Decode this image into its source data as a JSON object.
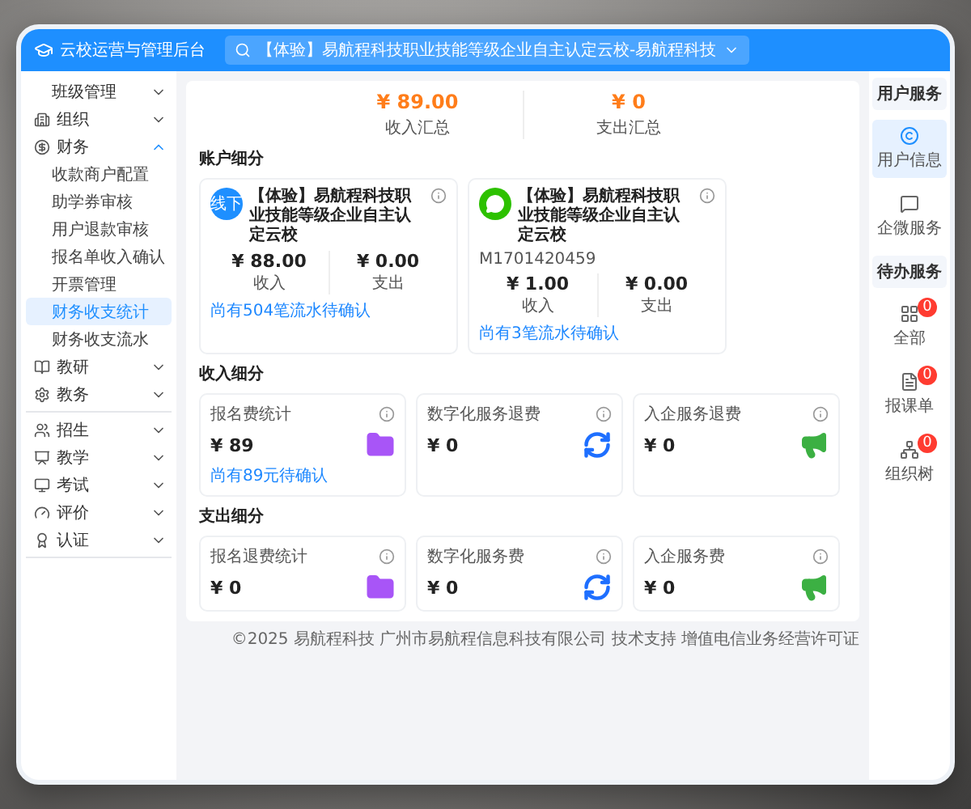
{
  "app": {
    "title": "云校运营与管理后台",
    "search": {
      "value": "【体验】易航程科技职业技能等级企业自主认定云校-易航程科技"
    }
  },
  "sidebar": {
    "groups": [
      [
        {
          "label": "班级管理",
          "kind": "submenu",
          "expanded": false
        },
        {
          "label": "组织",
          "kind": "module",
          "expanded": false
        },
        {
          "label": "财务",
          "kind": "module",
          "expanded": true,
          "children": [
            {
              "label": "收款商户配置",
              "selected": false
            },
            {
              "label": "助学券审核",
              "selected": false
            },
            {
              "label": "用户退款审核",
              "selected": false
            },
            {
              "label": "报名单收入确认",
              "selected": false
            },
            {
              "label": "开票管理",
              "selected": false
            },
            {
              "label": "财务收支统计",
              "selected": true
            },
            {
              "label": "财务收支流水",
              "selected": false
            }
          ]
        },
        {
          "label": "教研",
          "kind": "module",
          "expanded": false
        },
        {
          "label": "教务",
          "kind": "module",
          "expanded": false
        }
      ],
      [
        {
          "label": "招生",
          "kind": "module",
          "expanded": false
        },
        {
          "label": "教学",
          "kind": "module",
          "expanded": false
        },
        {
          "label": "考试",
          "kind": "module",
          "expanded": false
        },
        {
          "label": "评价",
          "kind": "module",
          "expanded": false
        },
        {
          "label": "认证",
          "kind": "module",
          "expanded": false
        }
      ]
    ]
  },
  "summary": [
    {
      "amount": "¥ 89.00",
      "label": "收入汇总"
    },
    {
      "amount": "¥ 0",
      "label": "支出汇总"
    }
  ],
  "accounts": {
    "title": "账户细分",
    "cards": [
      {
        "kind": "offline",
        "badge": "线下",
        "name": "【体验】易航程科技职业技能等级企业自主认定云校",
        "income": "¥ 88.00",
        "income_label": "收入",
        "expense": "¥ 0.00",
        "expense_label": "支出",
        "link": "尚有504笔流水待确认"
      },
      {
        "kind": "wechat",
        "name": "【体验】易航程科技职业技能等级企业自主认定云校",
        "id": "M1701420459",
        "income": "¥ 1.00",
        "income_label": "收入",
        "expense": "¥ 0.00",
        "expense_label": "支出",
        "link": "尚有3笔流水待确认"
      }
    ]
  },
  "sections": [
    {
      "title": "收入细分",
      "cards": [
        {
          "kind": "folder",
          "title": "报名费统计",
          "amount": "¥ 89",
          "link": "尚有89元待确认"
        },
        {
          "kind": "digital",
          "title": "数字化服务退费",
          "amount": "¥ 0"
        },
        {
          "kind": "enterprise",
          "title": "入企服务退费",
          "amount": "¥ 0"
        }
      ]
    },
    {
      "title": "支出细分",
      "cards": [
        {
          "kind": "folder",
          "title": "报名退费统计",
          "amount": "¥ 0"
        },
        {
          "kind": "digital",
          "title": "数字化服务费",
          "amount": "¥ 0"
        },
        {
          "kind": "enterprise",
          "title": "入企服务费",
          "amount": "¥ 0"
        }
      ]
    }
  ],
  "footer": "©2025 易航程科技 广州市易航程信息科技有限公司 技术支持 增值电信业务经营许可证",
  "right_panel": [
    {
      "title": "用户服务",
      "items": [
        {
          "label": "用户信息",
          "kind": "user",
          "selected": true
        },
        {
          "label": "企微服务",
          "kind": "chat",
          "selected": false
        }
      ]
    },
    {
      "title": "待办服务",
      "items": [
        {
          "label": "全部",
          "kind": "all",
          "badge": "0",
          "selected": false
        },
        {
          "label": "报课单",
          "kind": "form",
          "badge": "0",
          "selected": false
        },
        {
          "label": "组织树",
          "kind": "tree",
          "badge": "0",
          "selected": false
        }
      ]
    }
  ]
}
